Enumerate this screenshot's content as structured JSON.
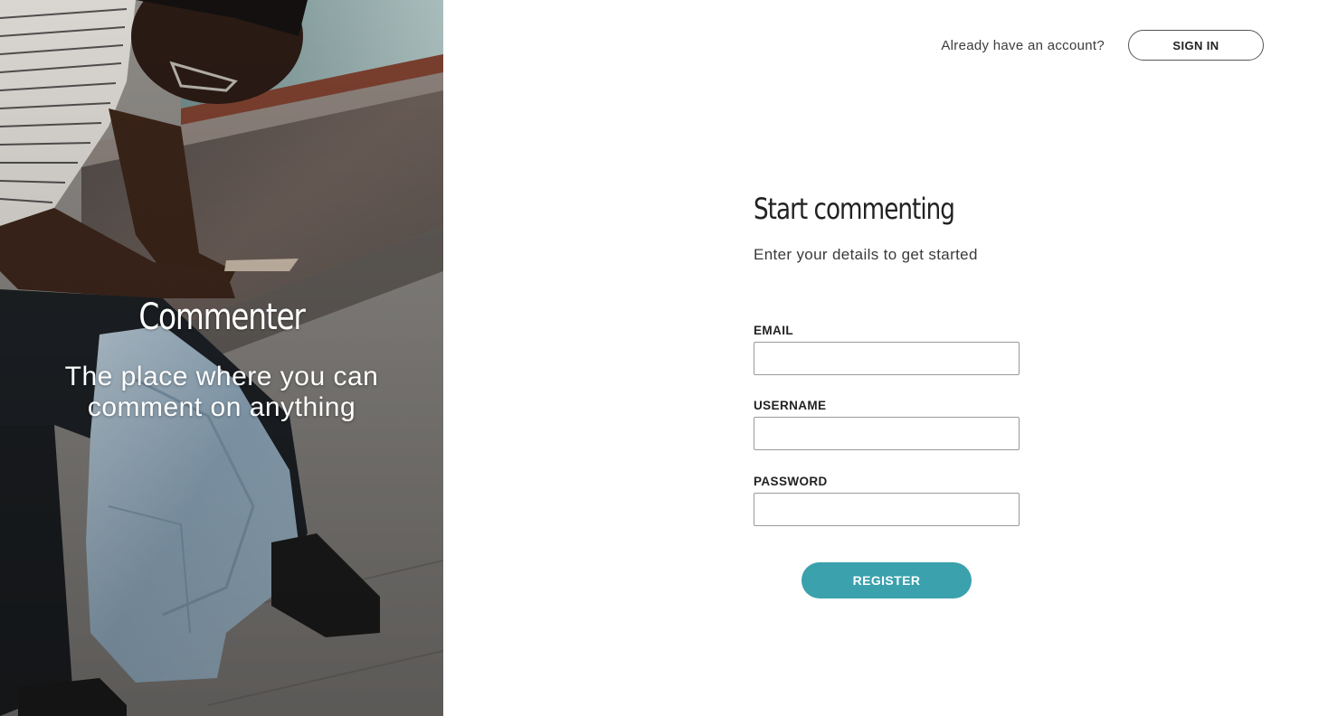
{
  "hero": {
    "brand": "Commenter",
    "tagline_line1": "The place where you can",
    "tagline_line2": "comment on anything",
    "image_description": "person-sitting-with-phone-photo"
  },
  "header": {
    "prompt": "Already have an account?",
    "signin_label": "SIGN IN"
  },
  "form": {
    "title": "Start commenting",
    "subtitle": "Enter your details to get started",
    "fields": [
      {
        "label": "EMAIL",
        "value": ""
      },
      {
        "label": "USERNAME",
        "value": ""
      },
      {
        "label": "PASSWORD",
        "value": ""
      }
    ],
    "submit_label": "REGISTER"
  },
  "colors": {
    "accent": "#3aa1ad",
    "text": "#222222",
    "border": "#9a9a9a"
  }
}
